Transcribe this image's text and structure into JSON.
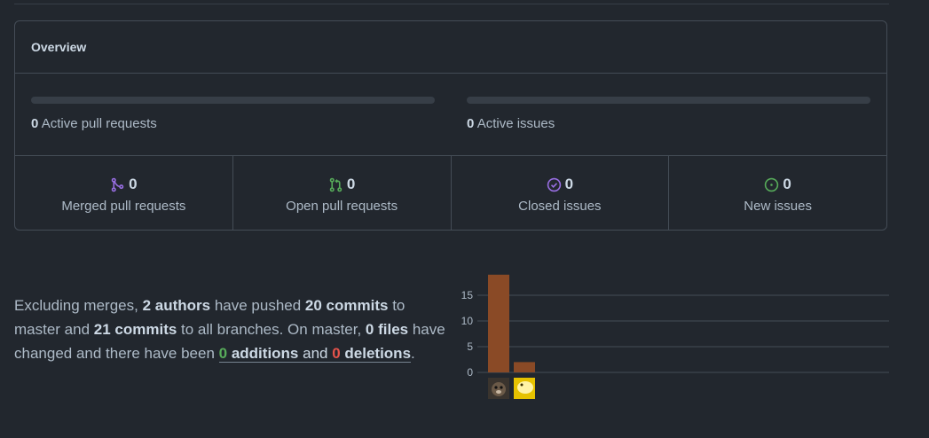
{
  "overview": {
    "title": "Overview",
    "active_prs": {
      "count": "0",
      "label": "Active pull requests"
    },
    "active_issues": {
      "count": "0",
      "label": "Active issues"
    },
    "stats": [
      {
        "value": "0",
        "label": "Merged pull requests",
        "icon": "git-merge-icon",
        "color": "#986ee2"
      },
      {
        "value": "0",
        "label": "Open pull requests",
        "icon": "git-pull-request-icon",
        "color": "#57ab5a"
      },
      {
        "value": "0",
        "label": "Closed issues",
        "icon": "issue-closed-icon",
        "color": "#986ee2"
      },
      {
        "value": "0",
        "label": "New issues",
        "icon": "issue-opened-icon",
        "color": "#57ab5a"
      }
    ]
  },
  "summary": {
    "p1": "Excluding merges, ",
    "authors": "2 authors",
    "p2": " have pushed ",
    "commits_master": "20 commits",
    "p3": " to master and ",
    "commits_all": "21 commits",
    "p4": " to all branches. On master, ",
    "files": "0 files",
    "p5": " have changed and there have been ",
    "additions_num": "0",
    "additions_word": " additions",
    "and_word": " and ",
    "deletions_num": "0",
    "deletions_word": " deletions",
    "end": "."
  },
  "chart_data": {
    "type": "bar",
    "categories": [
      "contributor-1",
      "contributor-2"
    ],
    "values": [
      19,
      2
    ],
    "yticks": [
      0,
      5,
      10,
      15
    ],
    "ylim": [
      0,
      19
    ],
    "bar_color": "#8a4a26",
    "grid": true
  }
}
